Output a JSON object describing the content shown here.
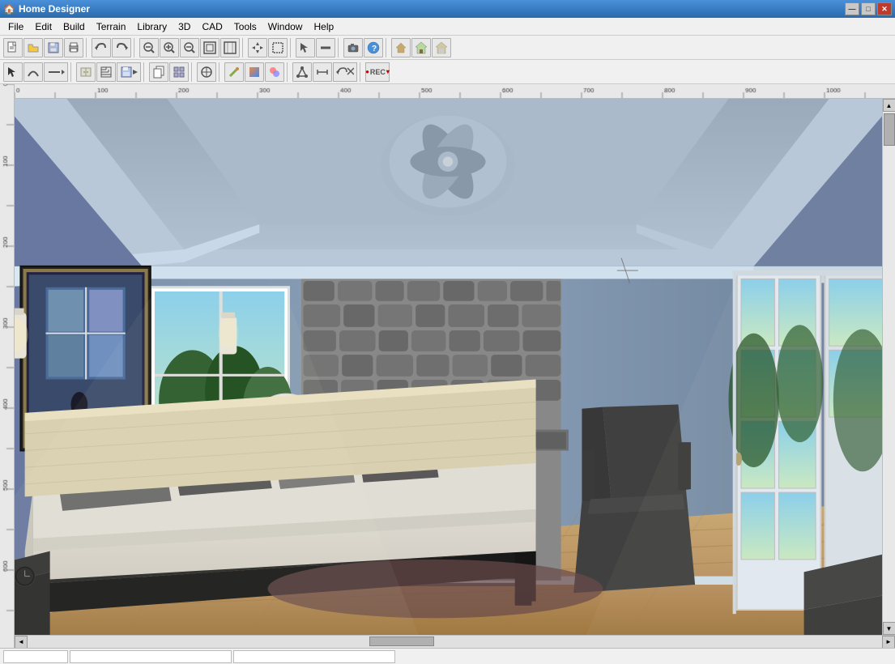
{
  "titleBar": {
    "title": "Home Designer",
    "icon": "🏠",
    "controls": {
      "minimize": "—",
      "maximize": "□",
      "close": "✕"
    }
  },
  "menuBar": {
    "items": [
      {
        "label": "File",
        "id": "file"
      },
      {
        "label": "Edit",
        "id": "edit"
      },
      {
        "label": "Build",
        "id": "build"
      },
      {
        "label": "Terrain",
        "id": "terrain"
      },
      {
        "label": "Library",
        "id": "library"
      },
      {
        "label": "3D",
        "id": "3d"
      },
      {
        "label": "CAD",
        "id": "cad"
      },
      {
        "label": "Tools",
        "id": "tools"
      },
      {
        "label": "Window",
        "id": "window"
      },
      {
        "label": "Help",
        "id": "help"
      }
    ]
  },
  "toolbar1": {
    "buttons": [
      {
        "id": "new",
        "icon": "📄",
        "tooltip": "New"
      },
      {
        "id": "open",
        "icon": "📁",
        "tooltip": "Open"
      },
      {
        "id": "save",
        "icon": "💾",
        "tooltip": "Save"
      },
      {
        "id": "print",
        "icon": "🖨",
        "tooltip": "Print"
      },
      {
        "id": "undo",
        "icon": "↩",
        "tooltip": "Undo"
      },
      {
        "id": "redo",
        "icon": "↪",
        "tooltip": "Redo"
      },
      {
        "id": "zoom-out-small",
        "icon": "🔍",
        "tooltip": "Zoom Out"
      },
      {
        "id": "zoom-in",
        "icon": "🔍",
        "tooltip": "Zoom In"
      },
      {
        "id": "zoom-out",
        "icon": "🔎",
        "tooltip": "Zoom Out"
      },
      {
        "id": "fit",
        "icon": "⊞",
        "tooltip": "Fit"
      },
      {
        "id": "fit-page",
        "icon": "⊟",
        "tooltip": "Fit Page"
      },
      {
        "id": "pan",
        "icon": "✋",
        "tooltip": "Pan"
      },
      {
        "id": "select-all",
        "icon": "⊡",
        "tooltip": "Select All"
      },
      {
        "id": "roof",
        "icon": "⌂",
        "tooltip": "Roof"
      },
      {
        "id": "arrow-up",
        "icon": "↑",
        "tooltip": "Arrow"
      },
      {
        "id": "wall",
        "icon": "▦",
        "tooltip": "Wall"
      },
      {
        "id": "camera",
        "icon": "📷",
        "tooltip": "Camera"
      },
      {
        "id": "help",
        "icon": "?",
        "tooltip": "Help"
      },
      {
        "id": "house1",
        "icon": "🏠",
        "tooltip": "House 1"
      },
      {
        "id": "house2",
        "icon": "🏡",
        "tooltip": "House 2"
      },
      {
        "id": "house3",
        "icon": "⌂",
        "tooltip": "House 3"
      }
    ]
  },
  "toolbar2": {
    "buttons": [
      {
        "id": "select",
        "icon": "↖",
        "tooltip": "Select"
      },
      {
        "id": "curve",
        "icon": "∿",
        "tooltip": "Curve"
      },
      {
        "id": "wall-tool",
        "icon": "┤",
        "tooltip": "Wall Tool"
      },
      {
        "id": "cabinet",
        "icon": "▥",
        "tooltip": "Cabinet"
      },
      {
        "id": "stairs",
        "icon": "⬛",
        "tooltip": "Stairs"
      },
      {
        "id": "save2",
        "icon": "💾",
        "tooltip": "Save"
      },
      {
        "id": "copy-paste",
        "icon": "📋",
        "tooltip": "Copy/Paste"
      },
      {
        "id": "group",
        "icon": "▣",
        "tooltip": "Group"
      },
      {
        "id": "snap",
        "icon": "⊕",
        "tooltip": "Snap"
      },
      {
        "id": "paint",
        "icon": "🖌",
        "tooltip": "Paint"
      },
      {
        "id": "gradient",
        "icon": "▨",
        "tooltip": "Gradient"
      },
      {
        "id": "material",
        "icon": "🎨",
        "tooltip": "Material"
      },
      {
        "id": "transform",
        "icon": "⊛",
        "tooltip": "Transform"
      },
      {
        "id": "dimension",
        "icon": "↔",
        "tooltip": "Dimension"
      },
      {
        "id": "move",
        "icon": "⊕",
        "tooltip": "Move"
      },
      {
        "id": "rotate",
        "icon": "↻",
        "tooltip": "Rotate"
      },
      {
        "id": "record",
        "icon": "⬤",
        "tooltip": "Record",
        "label": "REC"
      }
    ]
  },
  "statusBar": {
    "panels": [
      "",
      "",
      ""
    ]
  },
  "scene": {
    "description": "3D bedroom interior with fireplace, bed, and French doors"
  }
}
